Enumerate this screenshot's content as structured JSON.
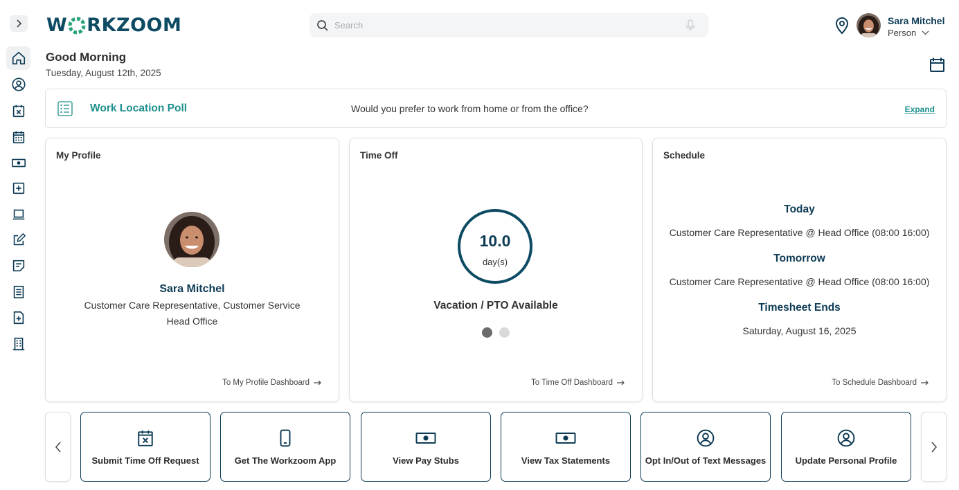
{
  "brand": {
    "logo_left": "W",
    "logo_right": "RKZOOM"
  },
  "search": {
    "placeholder": "Search"
  },
  "user": {
    "name": "Sara Mitchel",
    "role": "Person"
  },
  "greeting": {
    "title": "Good Morning",
    "date": "Tuesday, August 12th, 2025"
  },
  "poll": {
    "title": "Work Location Poll",
    "question": "Would you prefer to work from home or from the office?",
    "expand_label": "Expand"
  },
  "sidebar": {
    "items": [
      {
        "icon": "home-icon",
        "active": true
      },
      {
        "icon": "user-circle-icon"
      },
      {
        "icon": "calendar-x-icon"
      },
      {
        "icon": "calendar-grid-icon"
      },
      {
        "icon": "money-icon"
      },
      {
        "icon": "plus-square-icon"
      },
      {
        "icon": "laptop-icon"
      },
      {
        "icon": "edit-icon"
      },
      {
        "icon": "note-icon"
      },
      {
        "icon": "document-icon"
      },
      {
        "icon": "file-plus-icon"
      },
      {
        "icon": "building-icon"
      }
    ]
  },
  "profile_card": {
    "title": "My Profile",
    "name": "Sara Mitchel",
    "position": "Customer Care Representative, Customer Service",
    "location": "Head Office",
    "link": "To My Profile Dashboard"
  },
  "timeoff_card": {
    "title": "Time Off",
    "value": "10.0",
    "unit": "day(s)",
    "label": "Vacation / PTO Available",
    "carousel": {
      "pages": 2,
      "active_page": 1
    },
    "link": "To Time Off Dashboard"
  },
  "schedule_card": {
    "title": "Schedule",
    "today_label": "Today",
    "today_text": "Customer Care Representative @ Head Office (08:00 16:00)",
    "tomorrow_label": "Tomorrow",
    "tomorrow_text": "Customer Care Representative @ Head Office (08:00 16:00)",
    "timesheet_label": "Timesheet Ends",
    "timesheet_text": "Saturday, August 16, 2025",
    "link": "To Schedule Dashboard"
  },
  "quick_actions": [
    {
      "label": "Submit Time Off Request",
      "icon": "calendar-x-icon"
    },
    {
      "label": "Get The Workzoom App",
      "icon": "phone-icon"
    },
    {
      "label": "View Pay Stubs",
      "icon": "money-icon"
    },
    {
      "label": "View Tax Statements",
      "icon": "money-icon"
    },
    {
      "label": "Opt In/Out of Text Messages",
      "icon": "user-circle-icon"
    },
    {
      "label": "Update Personal Profile",
      "icon": "user-circle-icon"
    }
  ],
  "colors": {
    "navy": "#0d3b55",
    "teal": "#1d8f8c",
    "border": "#dcdfe2"
  }
}
